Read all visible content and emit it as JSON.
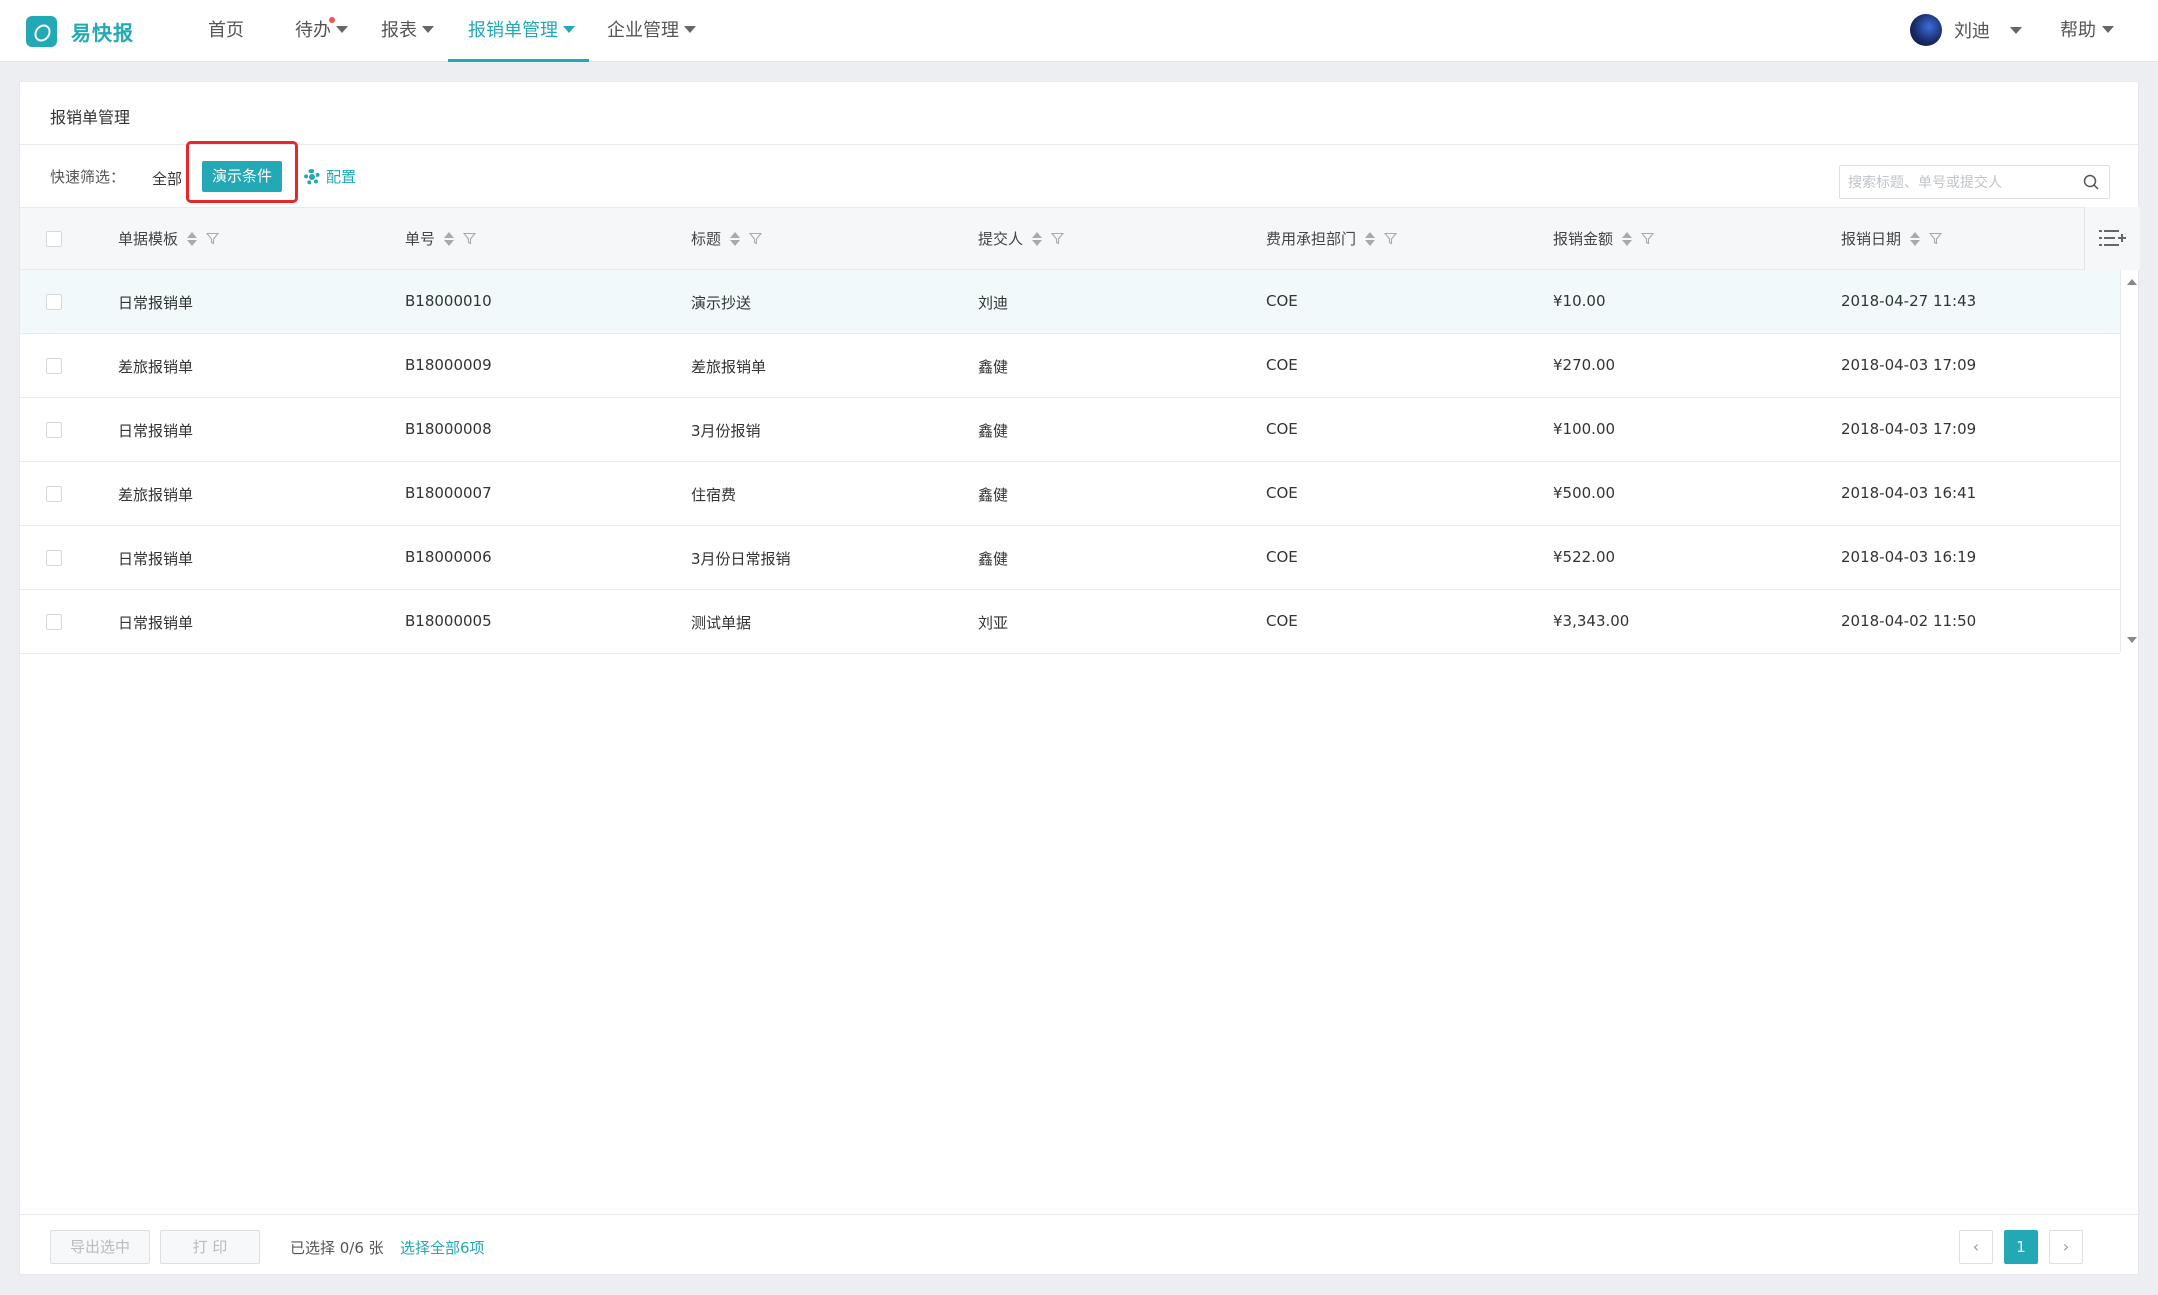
{
  "app": {
    "name": "易快报"
  },
  "nav": {
    "items": [
      {
        "label": "首页"
      },
      {
        "label": "待办"
      },
      {
        "label": "报表"
      },
      {
        "label": "报销单管理"
      },
      {
        "label": "企业管理"
      }
    ],
    "user_name": "刘迪",
    "help_label": "帮助"
  },
  "card": {
    "title": "报销单管理",
    "filter_label": "快速筛选：",
    "filter_all": "全部",
    "filter_demo": "演示条件",
    "config_label": "配置",
    "search_placeholder": "搜索标题、单号或提交人"
  },
  "table": {
    "columns": [
      "单据模板",
      "单号",
      "标题",
      "提交人",
      "费用承担部门",
      "报销金额",
      "报销日期"
    ],
    "rows": [
      [
        "日常报销单",
        "B18000010",
        "演示抄送",
        "刘迪",
        "COE",
        "¥10.00",
        "2018-04-27 11:43"
      ],
      [
        "差旅报销单",
        "B18000009",
        "差旅报销单",
        "鑫健",
        "COE",
        "¥270.00",
        "2018-04-03 17:09"
      ],
      [
        "日常报销单",
        "B18000008",
        "3月份报销",
        "鑫健",
        "COE",
        "¥100.00",
        "2018-04-03 17:09"
      ],
      [
        "差旅报销单",
        "B18000007",
        "住宿费",
        "鑫健",
        "COE",
        "¥500.00",
        "2018-04-03 16:41"
      ],
      [
        "日常报销单",
        "B18000006",
        "3月份日常报销",
        "鑫健",
        "COE",
        "¥522.00",
        "2018-04-03 16:19"
      ],
      [
        "日常报销单",
        "B18000005",
        "测试单据",
        "刘亚",
        "COE",
        "¥3,343.00",
        "2018-04-02 11:50"
      ]
    ]
  },
  "footer": {
    "export_label": "导出选中",
    "print_label": "打 印",
    "selected_info": "已选择 0/6 张",
    "select_all_label": "选择全部6项",
    "prev": "‹",
    "current_page": "1",
    "next": "›"
  },
  "colors": {
    "accent": "#23a8b6",
    "highlight": "#e8262c",
    "dot": "#f0505a"
  }
}
